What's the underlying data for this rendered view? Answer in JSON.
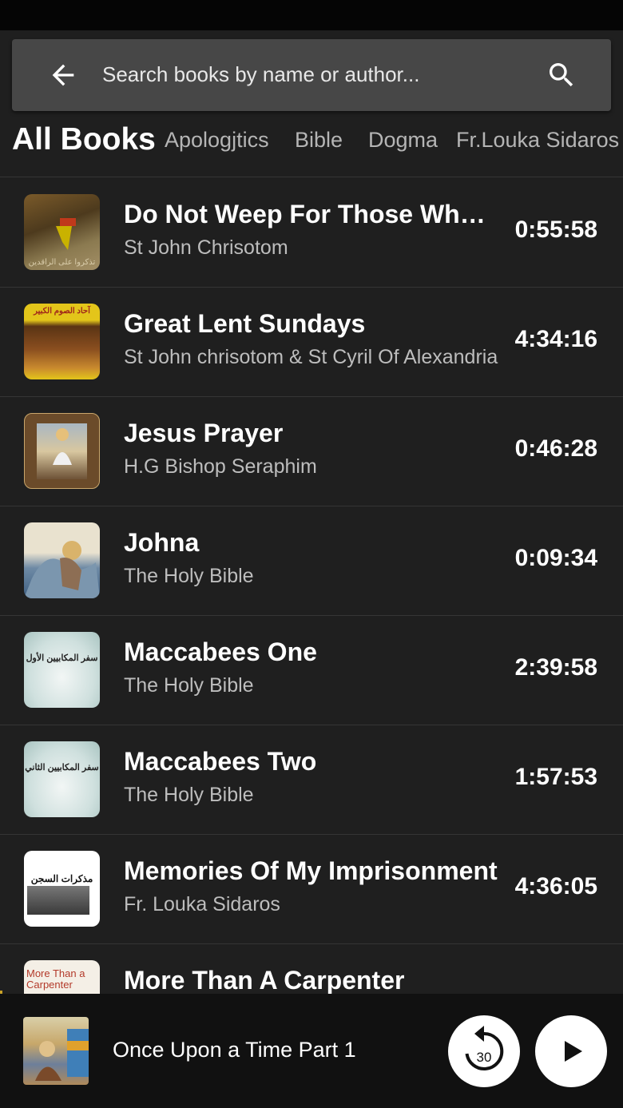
{
  "search": {
    "placeholder": "Search books by name or author..."
  },
  "tabs": [
    {
      "label": "All Books",
      "active": true
    },
    {
      "label": "Apologjtics",
      "active": false
    },
    {
      "label": "Bible",
      "active": false
    },
    {
      "label": "Dogma",
      "active": false
    },
    {
      "label": "Fr.Louka Sidaros",
      "active": false
    }
  ],
  "books": [
    {
      "title": "Do Not Weep For Those Who  hav...",
      "author": "St John Chrisotom",
      "duration": "0:55:58",
      "thumb_text": "تذكروا على الراقدين"
    },
    {
      "title": "Great Lent Sundays",
      "author": "St John chrisotom & St Cyril Of Alexandria",
      "duration": "4:34:16",
      "thumb_text": "آحاد الصوم الكبير"
    },
    {
      "title": "Jesus Prayer",
      "author": "H.G Bishop Seraphim",
      "duration": "0:46:28",
      "thumb_text": ""
    },
    {
      "title": "Johna",
      "author": "The  Holy Bible",
      "duration": "0:09:34",
      "thumb_text": ""
    },
    {
      "title": "Maccabees One",
      "author": "The Holy Bible",
      "duration": "2:39:58",
      "thumb_text": "سفر المكابيين الأول"
    },
    {
      "title": "Maccabees Two",
      "author": "The Holy Bible",
      "duration": "1:57:53",
      "thumb_text": "سفر المكابيين الثاني"
    },
    {
      "title": "Memories Of My Imprisonment",
      "author": "Fr. Louka Sidaros",
      "duration": "4:36:05",
      "thumb_text": "مذكرات السجن"
    },
    {
      "title": "More Than A Carpenter",
      "author": "",
      "duration": "",
      "thumb_text": "More Than a Carpenter"
    }
  ],
  "player": {
    "title": "Once Upon a Time Part 1",
    "rewind_seconds": "30"
  },
  "icons": {
    "back": "arrow-left-icon",
    "search": "magnifier-icon",
    "rewind": "replay-30-icon",
    "play": "play-icon"
  }
}
